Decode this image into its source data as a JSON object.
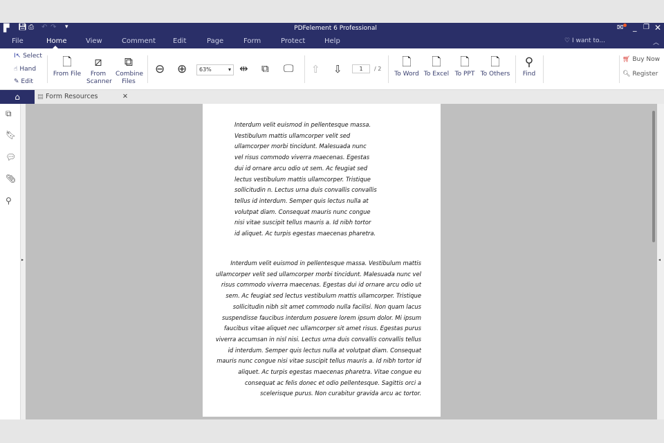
{
  "app": {
    "title": "PDFelement 6 Professional"
  },
  "menu": [
    "File",
    "Home",
    "View",
    "Comment",
    "Edit",
    "Page",
    "Form",
    "Protect",
    "Help"
  ],
  "iwant": "I want to...",
  "ribbon": {
    "select": "Select",
    "hand": "Hand",
    "edit": "Edit",
    "from_file": "From File",
    "from_scanner": "From Scanner",
    "combine_files": "Combine Files",
    "zoom": "63%",
    "page_current": "1",
    "page_total": "/ 2",
    "to_word": "To Word",
    "to_excel": "To Excel",
    "to_ppt": "To PPT",
    "to_others": "To Others",
    "find": "Find",
    "buy_now": "Buy Now",
    "register": "Register"
  },
  "tab": {
    "label": "Form Resources"
  },
  "doc": {
    "para1": [
      "Interdum velit euismod in pellentesque massa.",
      "Vestibulum mattis ullamcorper velit sed",
      "ullamcorper morbi tincidunt. Malesuada nunc",
      "vel risus commodo viverra maecenas. Egestas",
      "dui id ornare arcu odio ut sem. Ac feugiat sed",
      "lectus vestibulum mattis ullamcorper. Tristique",
      "sollicitudin n. Lectus urna duis convallis convallis",
      "tellus id interdum. Semper quis lectus nulla at",
      "volutpat diam. Consequat mauris nunc congue",
      "nisi vitae suscipit tellus mauris a. Id nibh tortor",
      "id aliquet. Ac turpis egestas maecenas pharetra."
    ],
    "para2": [
      "Interdum velit euismod in pellentesque massa. Vestibulum mattis",
      "ullamcorper velit sed ullamcorper morbi tincidunt. Malesuada nunc vel",
      "risus commodo viverra maecenas. Egestas dui id ornare arcu odio ut",
      "sem. Ac feugiat sed lectus vestibulum mattis ullamcorper. Tristique",
      "sollicitudin nibh sit amet commodo nulla facilisi. Non quam lacus",
      "suspendisse faucibus interdum posuere lorem ipsum dolor. Mi ipsum",
      "faucibus vitae aliquet nec ullamcorper sit amet risus. Egestas purus",
      "viverra accumsan in nisl nisi. Lectus urna duis convallis convallis tellus",
      "id interdum. Semper quis lectus nulla at volutpat diam. Consequat",
      "mauris nunc congue nisi vitae suscipit tellus mauris a. Id nibh tortor id",
      "aliquet. Ac turpis egestas maecenas pharetra. Vitae congue eu",
      "consequat ac felis donec et odio pellentesque. Sagittis orci a",
      "scelerisque purus. Non curabitur gravida arcu ac tortor."
    ]
  }
}
